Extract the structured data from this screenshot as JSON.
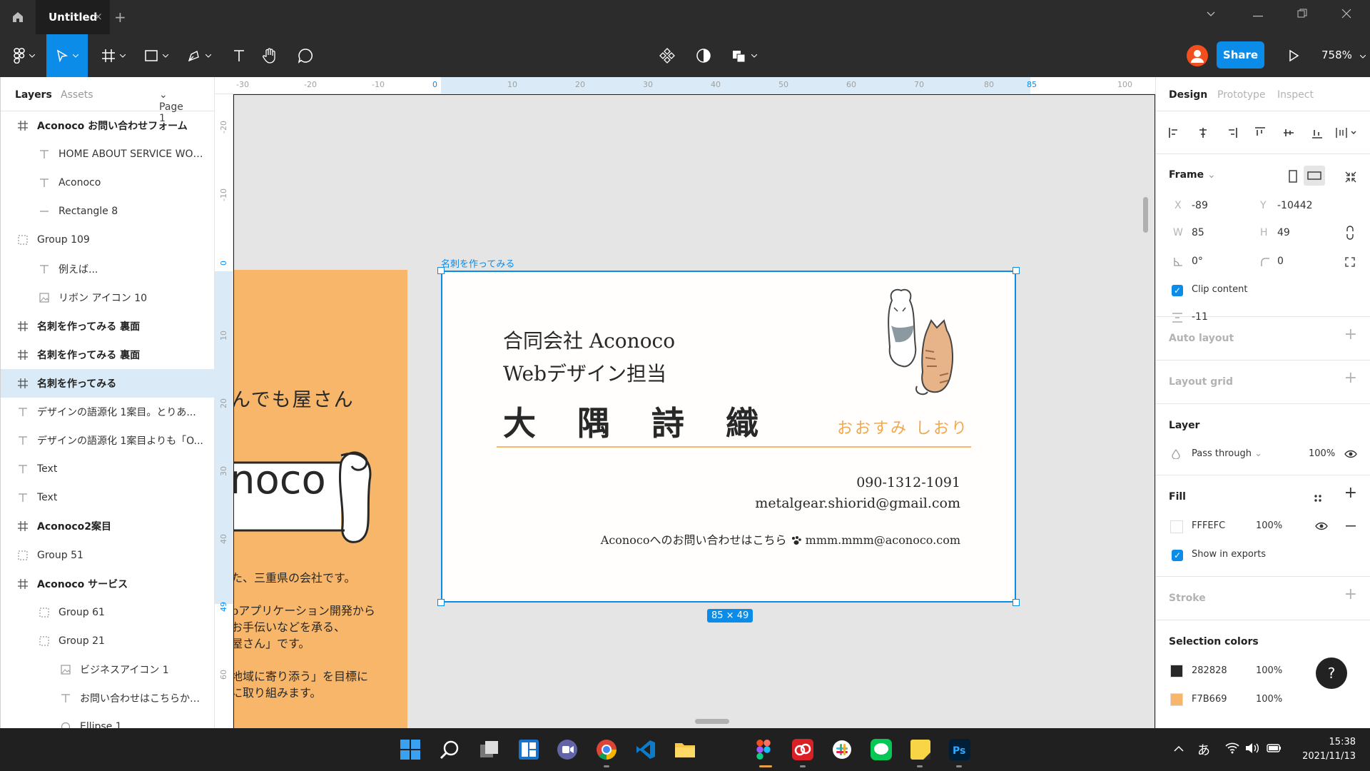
{
  "titlebar": {
    "tab_title": "Untitled",
    "tab_close": "×",
    "new_tab": "+"
  },
  "toolbar": {
    "share_label": "Share",
    "zoom_label": "758%"
  },
  "left_panel": {
    "tabs": {
      "layers": "Layers",
      "assets": "Assets",
      "page": "Page 1"
    },
    "layers": [
      {
        "label": "Aconoco お問い合わせフォーム",
        "icon": "frame-icon",
        "indent": 0,
        "bold": true
      },
      {
        "label": "HOME ABOUT SERVICE WOR...",
        "icon": "text-icon",
        "indent": 1,
        "bold": false
      },
      {
        "label": "Aconoco",
        "icon": "text-icon",
        "indent": 1,
        "bold": false
      },
      {
        "label": "Rectangle 8",
        "icon": "line-icon",
        "indent": 1,
        "bold": false
      },
      {
        "label": "Group 109",
        "icon": "group-icon",
        "indent": 0,
        "bold": false
      },
      {
        "label": "例えば...",
        "icon": "text-icon",
        "indent": 1,
        "bold": false
      },
      {
        "label": "リボン アイコン 10",
        "icon": "image-icon",
        "indent": 1,
        "bold": false
      },
      {
        "label": "名刺を作ってみる 裏面",
        "icon": "frame-icon",
        "indent": 0,
        "bold": true
      },
      {
        "label": "名刺を作ってみる 裏面",
        "icon": "frame-icon",
        "indent": 0,
        "bold": true
      },
      {
        "label": "名刺を作ってみる",
        "icon": "frame-icon",
        "indent": 0,
        "bold": true,
        "selected": true
      },
      {
        "label": "デザインの語源化 1案目。とりあ...",
        "icon": "text-icon",
        "indent": 0,
        "bold": false
      },
      {
        "label": "デザインの語源化 1案目よりも「O...",
        "icon": "text-icon",
        "indent": 0,
        "bold": false
      },
      {
        "label": "Text",
        "icon": "text-icon",
        "indent": 0,
        "bold": false
      },
      {
        "label": "Text",
        "icon": "text-icon",
        "indent": 0,
        "bold": false
      },
      {
        "label": "Aconoco2案目",
        "icon": "frame-icon",
        "indent": 0,
        "bold": true
      },
      {
        "label": "Group 51",
        "icon": "group-icon",
        "indent": 0,
        "bold": false
      },
      {
        "label": "Aconoco サービス",
        "icon": "frame-icon",
        "indent": 0,
        "bold": true
      },
      {
        "label": "Group 61",
        "icon": "group-icon",
        "indent": 1,
        "bold": false
      },
      {
        "label": "Group 21",
        "icon": "group-icon",
        "indent": 1,
        "bold": false
      },
      {
        "label": "ビジネスアイコン 1",
        "icon": "image-icon",
        "indent": 2,
        "bold": false
      },
      {
        "label": "お問い合わせはこちらから...",
        "icon": "text-icon",
        "indent": 2,
        "bold": false
      },
      {
        "label": "Ellipse 1",
        "icon": "ellipse-icon",
        "indent": 2,
        "bold": false
      }
    ]
  },
  "rulers": {
    "h": [
      "-30",
      "-20",
      "-10",
      "0",
      "10",
      "20",
      "30",
      "40",
      "50",
      "60",
      "70",
      "80",
      "85",
      "100"
    ],
    "v": [
      "-20",
      "-10",
      "0",
      "10",
      "20",
      "30",
      "40",
      "49",
      "60"
    ]
  },
  "canvas": {
    "frame_title": "名刺を作ってみる",
    "size_badge": "85 × 49",
    "orange_frame": {
      "line1": "んでも屋さん",
      "logo": "noco",
      "para": [
        "た、三重県の会社です。",
        "bアプリケーション開発から",
        "お手伝いなどを承る、",
        "屋さん」です。",
        "地域に寄り添う」を目標に",
        "に取り組みます。"
      ]
    },
    "card": {
      "company": "合同会社 Aconoco",
      "role": "Webデザイン担当",
      "name_chars": [
        "大",
        "隅",
        "詩",
        "織"
      ],
      "kana": "おおすみ しおり",
      "phone": "090-1312-1091",
      "email": "metalgear.shiorid@gmail.com",
      "contact_prefix": "Aconocoへのお問い合わせはこちら",
      "contact_email": "mmm.mmm@aconoco.com"
    }
  },
  "right_panel": {
    "tabs": {
      "design": "Design",
      "prototype": "Prototype",
      "inspect": "Inspect"
    },
    "frame": {
      "label": "Frame",
      "x_label": "X",
      "x": "-89",
      "y_label": "Y",
      "y": "-10442",
      "w_label": "W",
      "w": "85",
      "h_label": "H",
      "h": "49",
      "rotation": "0°",
      "radius": "0",
      "clip_content": "Clip content",
      "spacing": "-11"
    },
    "auto_layout": "Auto layout",
    "layout_grid": "Layout grid",
    "layer": {
      "label": "Layer",
      "blend": "Pass through",
      "opacity": "100%"
    },
    "fill": {
      "label": "Fill",
      "hex": "FFFEFC",
      "opacity": "100%",
      "show_in_exports": "Show in exports"
    },
    "stroke": "Stroke",
    "selection_colors": {
      "label": "Selection colors",
      "items": [
        {
          "hex": "282828",
          "opacity": "100%"
        },
        {
          "hex": "F7B669",
          "opacity": "100%"
        }
      ]
    },
    "help": "?"
  },
  "taskbar": {
    "time": "15:38",
    "date": "2021/11/13",
    "ime": "あ"
  },
  "colors": {
    "accent": "#0C8CE9",
    "orange": "#F7B669",
    "card_bg": "#FFFEFC",
    "text_dark": "#282828",
    "kana": "#F0A850"
  }
}
